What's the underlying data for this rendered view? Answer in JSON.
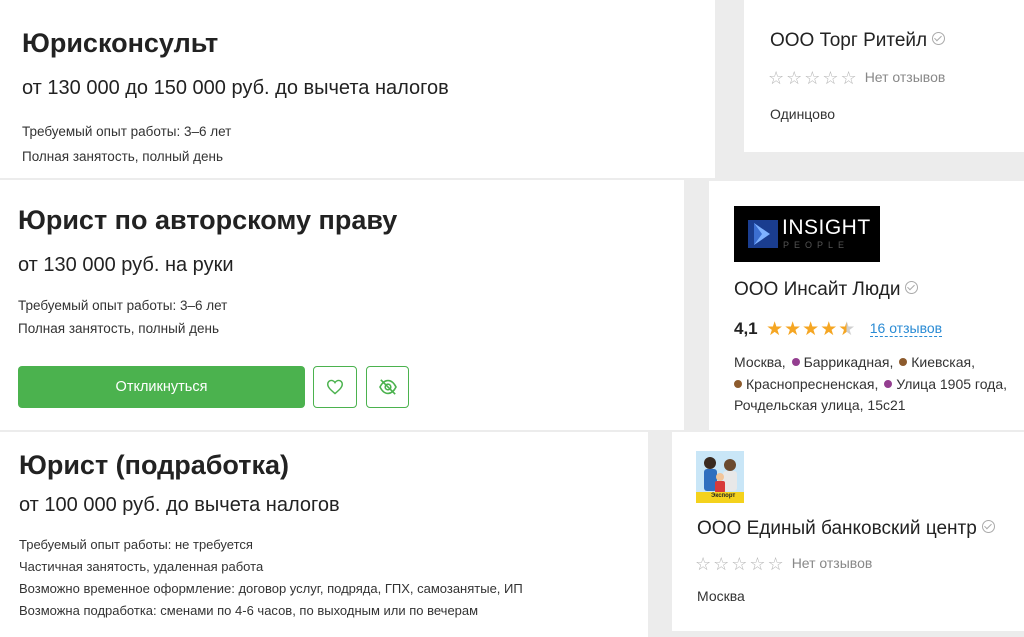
{
  "vacancies": [
    {
      "title": "Юрисконсульт",
      "salary": "от 130 000 до 150 000 руб. до вычета налогов",
      "details": [
        "Требуемый опыт работы: 3–6 лет",
        "Полная занятость, полный день"
      ]
    },
    {
      "title": "Юрист по авторскому праву",
      "salary": "от 130 000 руб. на руки",
      "details": [
        "Требуемый опыт работы: 3–6 лет",
        "Полная занятость, полный день"
      ],
      "apply_label": "Откликнуться"
    },
    {
      "title": "Юрист (подработка)",
      "salary": "от 100 000 руб. до вычета налогов",
      "details": [
        "Требуемый опыт работы: не требуется",
        "Частичная занятость, удаленная работа",
        "Возможно временное оформление: договор услуг, подряда, ГПХ, самозанятые, ИП",
        "Возможна подработка: сменами по 4-6 часов, по выходным или по вечерам"
      ]
    }
  ],
  "companies": [
    {
      "name": "ООО Торг Ритейл",
      "stars": "☆☆☆☆☆",
      "reviews": "Нет отзывов",
      "city": "Одинцово"
    },
    {
      "name": "ООО Инсайт Люди",
      "logo_text": "INSIGHT",
      "logo_sub": "PEOPLE",
      "rating": "4,1",
      "stars_full": "★★★★",
      "star_half": "★",
      "reviews": "16 отзывов",
      "addr": {
        "l1a": "Москва, ",
        "m1": "Баррикадная",
        "sep1": ", ",
        "m2": "Киевская",
        "end1": ",",
        "m3": "Краснопресненская",
        "sep2": ", ",
        "m4": "Улица 1905 года",
        "end2": ",",
        "l3": "Рочдельская улица, 15с21"
      },
      "metro_colors": {
        "purple": "#943e90",
        "brown": "#8d5b2d"
      }
    },
    {
      "name": "ООО Единый банковский центр",
      "logo_text": "Экспорт",
      "stars": "☆☆☆☆☆",
      "reviews": "Нет отзывов",
      "city": "Москва"
    }
  ],
  "colors": {
    "accent": "#4bb24e",
    "star": "#f5a623",
    "link": "#2a8bd4"
  }
}
